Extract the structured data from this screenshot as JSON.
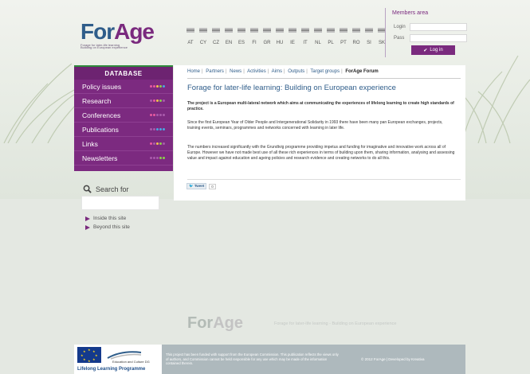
{
  "header": {
    "logo_part1": "For",
    "logo_part2": "Age",
    "logo_subtitle_line1": "Forage for later-life learning",
    "logo_subtitle_line2": "Building on European experience",
    "languages": [
      "AT",
      "CY",
      "CZ",
      "EN",
      "ES",
      "FI",
      "GR",
      "HU",
      "IE",
      "IT",
      "NL",
      "PL",
      "PT",
      "RO",
      "SI",
      "SK"
    ]
  },
  "members": {
    "title": "Members area",
    "login_label": "Login",
    "pass_label": "Pass",
    "login_button": "Log in"
  },
  "sidebar": {
    "title": "DATABASE",
    "items": [
      {
        "label": "Policy issues"
      },
      {
        "label": "Research"
      },
      {
        "label": "Conferences"
      },
      {
        "label": "Publications"
      },
      {
        "label": "Links"
      },
      {
        "label": "Newsletters"
      }
    ]
  },
  "search": {
    "label": "Search for",
    "option_site": "Inside this site",
    "option_beyond": "Beyond this site"
  },
  "nav": {
    "items": [
      "Home",
      "Partners",
      "News",
      "Activities",
      "Aims",
      "Outputs",
      "Target groups"
    ],
    "active": "ForAge Forum"
  },
  "main": {
    "title": "Forage for later-life learning: Building on European experience",
    "para1": "The project is a European multi-lateral network which aims at communicating the experiences of lifelong learning to create high standards of practice.",
    "para2": "Since the first European Year of Older People and Intergenerational Solidarity in 1993 there have been many pan European exchanges, projects, training events, seminars, programmes and networks concerned with learning in later life.",
    "para3": "The numbers increased significantly with the Grundtvig programme providing impetus and funding for imaginative and innovative work across all of Europe. However we have not made best use of all these rich experiences in terms of building upon them, sharing information, analysing and assessing value and impact against education and ageing policies and research evidence and creating networks to do all this.",
    "tweet_label": "Tweet",
    "tweet_count": "0"
  },
  "footer": {
    "logo_part1": "For",
    "logo_part2": "Age",
    "tagline": "Forage for later-life learning - Building on European experience",
    "eu_culture": "Education and Culture DG",
    "llp": "Lifelong Learning Programme",
    "disclaimer": "This project has been funded with support from the European Commission. This publication reflects the views only of authors, and Commission cannot be held responsible for any use which may be made of the information contained therein.",
    "copyright": "© 2012 ForAge | Developed by Kreativa"
  },
  "colors": {
    "brand_purple": "#7c2a80",
    "brand_blue": "#2f5d8a",
    "footer_bg": "#aeb9bd"
  }
}
